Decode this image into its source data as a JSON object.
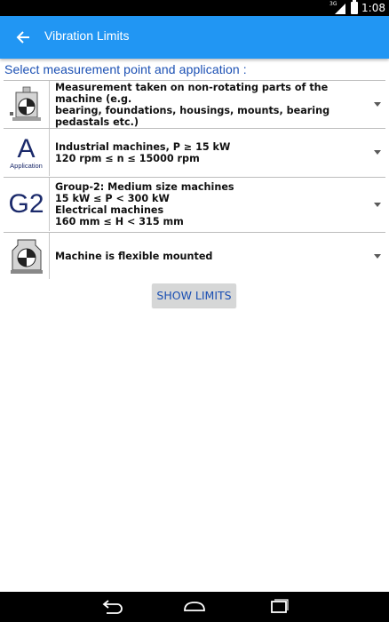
{
  "status_bar": {
    "network": "3G",
    "time": "1:08"
  },
  "app_bar": {
    "title": "Vibration Limits"
  },
  "heading": "Select measurement point and application :",
  "rows": [
    {
      "text_lines": [
        "Measurement taken on non-rotating parts of the machine (e.g.",
        "bearing, foundations, housings, mounts, bearing pedastals etc.)"
      ]
    },
    {
      "icon_letter": "A",
      "icon_label": "Application",
      "text_lines": [
        "Industrial machines, P ≥ 15 kW",
        "120 rpm ≤ n ≤ 15000 rpm"
      ]
    },
    {
      "icon_letter": "G2",
      "text_lines": [
        "Group-2: Medium size machines",
        "15 kW ≤ P < 300 kW",
        "Electrical machines",
        "160 mm ≤ H < 315 mm"
      ]
    },
    {
      "text_lines": [
        "Machine is flexible mounted"
      ]
    }
  ],
  "show_limits_button": "SHOW LIMITS",
  "colors": {
    "app_bar": "#2196f3",
    "heading": "#1a4fb3",
    "icon_text": "#1b2a6b",
    "button_bg": "#d6d7d7"
  }
}
